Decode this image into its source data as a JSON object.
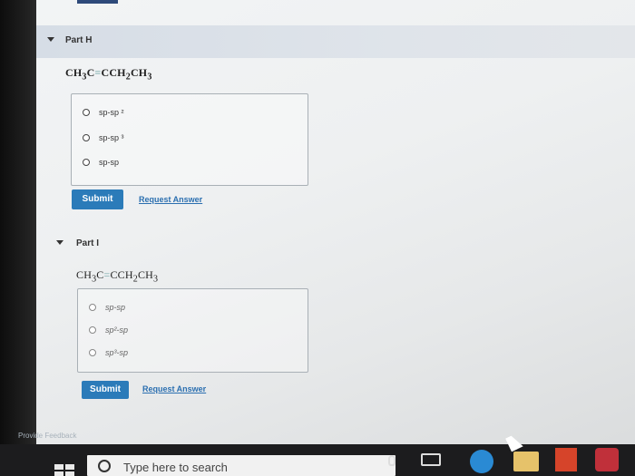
{
  "part_h": {
    "title": "Part H",
    "formula": {
      "left": "CH",
      "sub1": "3",
      "c": "C",
      "bond": "≡",
      "right": "CCH",
      "sub2": "2",
      "tail": "CH",
      "sub3": "3"
    },
    "choices": [
      "sp-sp ²",
      "sp-sp ³",
      "sp-sp"
    ],
    "submit_label": "Submit",
    "request_label": "Request Answer"
  },
  "part_i": {
    "title": "Part I",
    "formula": {
      "left": "CH",
      "sub1": "3",
      "c": "C",
      "bond": "=",
      "right": "CCH",
      "sub2": "2",
      "tail": "CH",
      "sub3": "3"
    },
    "choices": [
      "sp-sp",
      "sp²-sp",
      "sp³-sp"
    ],
    "submit_label": "Submit",
    "request_label": "Request Answer"
  },
  "feedback_label": "Provide Feedback",
  "taskbar": {
    "search_placeholder": "Type here to search"
  },
  "colors": {
    "accent": "#2b7bb9",
    "link": "#2b6fb0",
    "header": "#d6dde6"
  },
  "icons": [
    "windows-start-icon",
    "search-icon",
    "microphone-icon",
    "task-view-icon",
    "edge-icon",
    "file-explorer-icon",
    "office-icon",
    "mcafee-icon"
  ]
}
